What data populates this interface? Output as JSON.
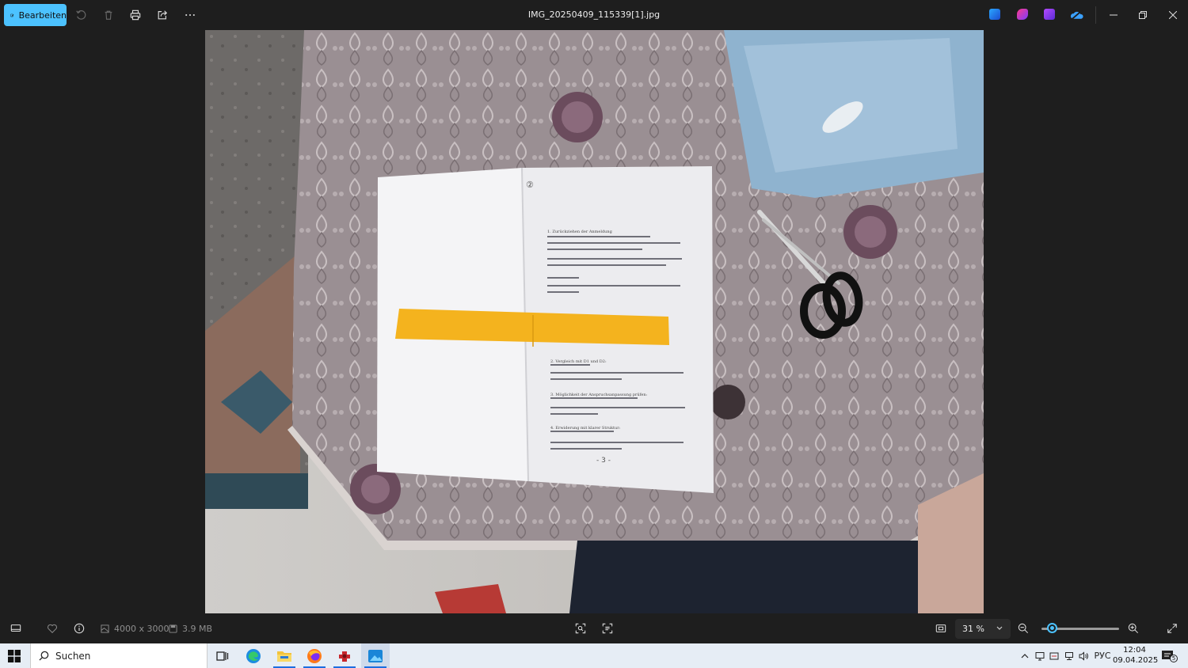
{
  "toolbar": {
    "edit_label": "Bearbeiten",
    "file_title": "IMG_20250409_115339[1].jpg"
  },
  "bottom": {
    "dimensions": "4000 x 3000",
    "filesize": "3.9 MB",
    "zoom_value": "31 %",
    "zoom_level": 0.08
  },
  "photo": {
    "document_heading_1": "1. Zurückziehen der Anmeldung",
    "page_mark_top": "②",
    "page_mark_bottom": "- 3 -",
    "section_2": "2. Vergleich mit D1 und D2:",
    "section_3": "3. Möglichkeit der Anspruchsanpassung prüfen:",
    "section_4": "4. Erwiderung mit klarer Struktur:"
  },
  "taskbar": {
    "search_placeholder": "Suchen",
    "language": "РУС",
    "time": "12:04",
    "date": "09.04.2025",
    "notification_count": "5"
  },
  "colors": {
    "accent": "#4cc2ff",
    "taskbar_bg": "#e6edf5",
    "app_bg": "#1e1e1e"
  }
}
